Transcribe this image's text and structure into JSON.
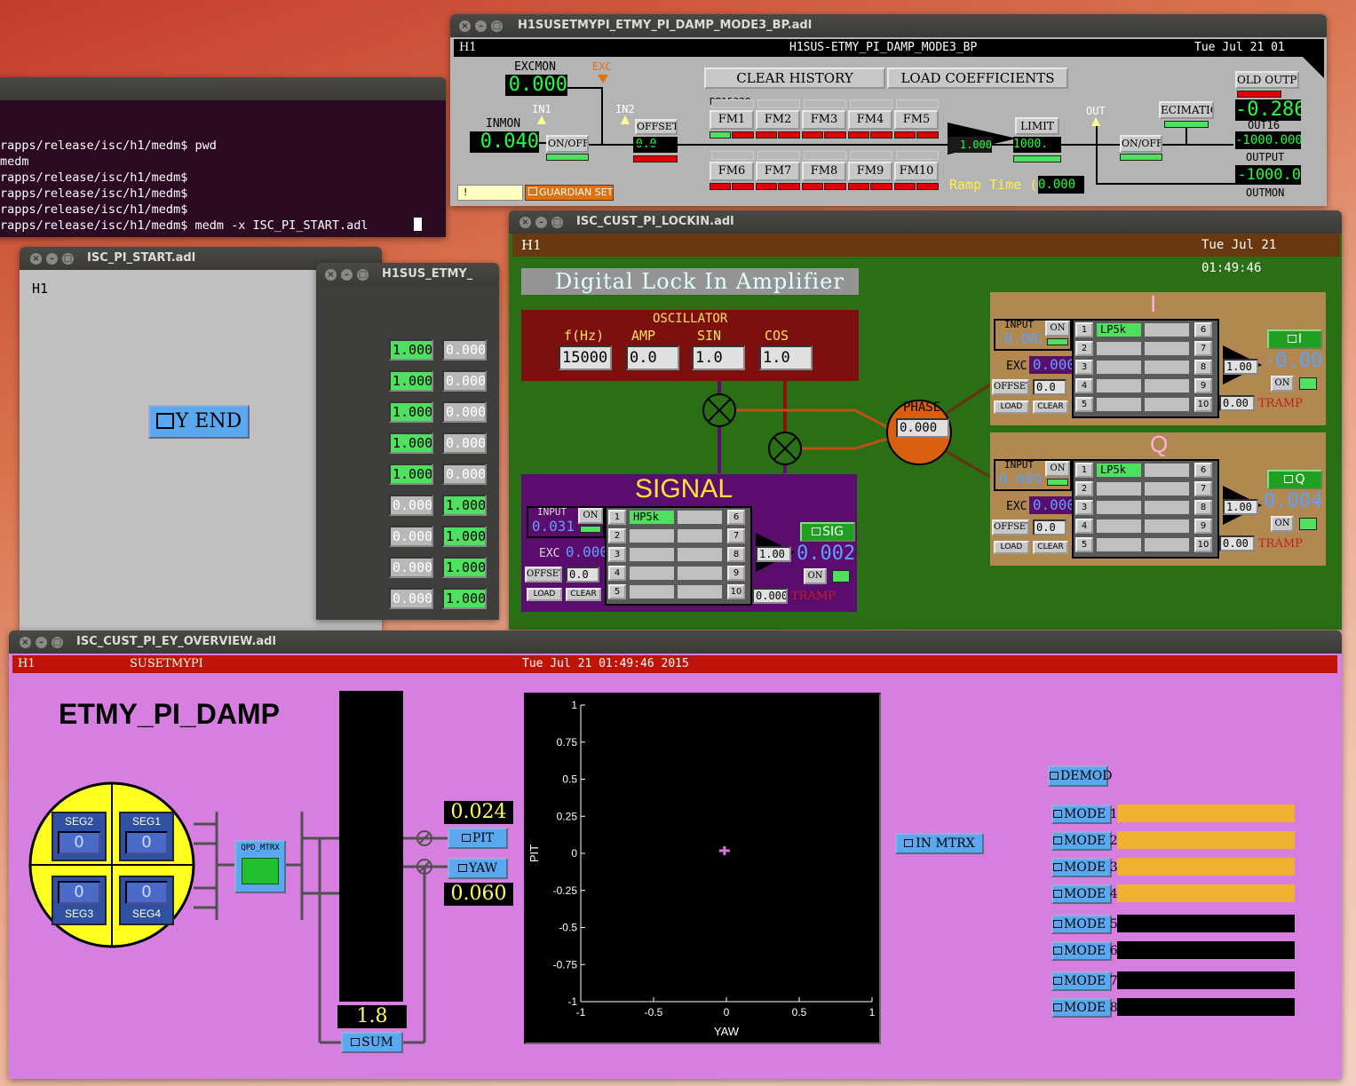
{
  "terminal": {
    "lines": [
      "rapps/release/isc/h1/medm$ pwd",
      "medm",
      "rapps/release/isc/h1/medm$",
      "rapps/release/isc/h1/medm$",
      "rapps/release/isc/h1/medm$",
      "rapps/release/isc/h1/medm$ medm -x ISC_PI_START.adl"
    ]
  },
  "bp": {
    "title": "H1SUSETMYPI_ETMY_PI_DAMP_MODE3_BP.adl",
    "ifo": "H1",
    "header": "H1SUS-ETMY_PI_DAMP_MODE3_BP",
    "date": "Tue Jul 21 01",
    "excmon_label": "EXCMON",
    "excmon_value": "0.000",
    "exc_label": "EXC",
    "inmon_label": "INMON",
    "inmon_value": "0.040",
    "in1": "IN1",
    "in2": "IN2",
    "onoff": "ON/OFF",
    "offset_label": "OFFSET",
    "offset_value": "0.0",
    "clear_history": "CLEAR HISTORY",
    "load_coeff": "LOAD COEFFICIENTS",
    "bp_label": "BP15328",
    "fm_top": [
      "FM1",
      "FM2",
      "FM3",
      "FM4",
      "FM5"
    ],
    "fm_bottom": [
      "FM6",
      "FM7",
      "FM8",
      "FM9",
      "FM10"
    ],
    "gain": "1.000",
    "limit_label": "LIMIT",
    "limit_value": "1000.",
    "out_label": "OUT",
    "onoff2": "ON/OFF",
    "decimation": "ECIMATIO",
    "hold_output": "OLD OUTPU",
    "out16_value": "-0.286",
    "out16_label": "OUT16",
    "output_value": "-1000.000",
    "output_label": "OUTPUT",
    "outmon_value": "-1000.0",
    "outmon_label": "OUTMON",
    "ramp_label": "Ramp Time (s",
    "ramp_value": "0.000",
    "excl": "!",
    "guardian": "GUARDIAN SET"
  },
  "start": {
    "title": "ISC_PI_START.adl",
    "ifo": "H1",
    "yend": "Y END"
  },
  "etmy": {
    "title": "H1SUS_ETMY_",
    "left": [
      "1.000",
      "1.000",
      "1.000",
      "1.000",
      "1.000",
      "0.000",
      "0.000",
      "0.000",
      "0.000"
    ],
    "right": [
      "0.000",
      "0.000",
      "0.000",
      "0.000",
      "0.000",
      "1.000",
      "1.000",
      "1.000",
      "1.000"
    ],
    "active_left": [
      true,
      true,
      true,
      true,
      true,
      false,
      false,
      false,
      false
    ]
  },
  "lockin": {
    "title": "ISC_CUST_PI_LOCKIN.adl",
    "ifo": "H1",
    "date": "Tue Jul 21 01:49:46",
    "heading": "Digital Lock In Amplifier",
    "oscillator": "OSCILLATOR",
    "osc_labels": [
      "f(Hz)",
      "AMP",
      "SIN",
      "COS"
    ],
    "osc_values": [
      "15000",
      "0.0",
      "1.0",
      "1.0"
    ],
    "phase_label": "PHASE",
    "phase_value": "0.000",
    "signal": {
      "title": "SIGNAL",
      "input_label": "INPUT",
      "input_value": "0.031",
      "on": "ON",
      "exc_label": "EXC",
      "exc_value": "0.000",
      "offset_label": "OFFSET",
      "offset_value": "0.0",
      "load": "LOAD",
      "clear": "CLEAR",
      "filter1": "HP5k",
      "gain": "1.00",
      "out_btn": "SIG",
      "out_value": "0.002",
      "tramp_value": "0.000",
      "tramp_label": "TRAMP"
    },
    "i": {
      "title": "I",
      "input_label": "INPUT",
      "input_value": "-0.002",
      "on": "ON",
      "exc_label": "EXC",
      "exc_value": "0.000",
      "offset_label": "OFFSET",
      "offset_value": "0.0",
      "load": "LOAD",
      "clear": "CLEAR",
      "filter1": "LP5k",
      "gain": "1.00",
      "out_btn": "I",
      "out_value": "-0.006",
      "tramp_value": "0.00",
      "tramp_label": "TRAMP"
    },
    "q": {
      "title": "Q",
      "input_label": "INPUT",
      "input_value": "0.009",
      "on": "ON",
      "exc_label": "EXC",
      "exc_value": "0.000",
      "offset_label": "OFFSET",
      "offset_value": "0.0",
      "load": "LOAD",
      "clear": "CLEAR",
      "filter1": "LP5k",
      "gain": "1.00",
      "out_btn": "Q",
      "out_value": "0.004",
      "tramp_value": "0.00",
      "tramp_label": "TRAMP"
    },
    "fm_nums_left": [
      "1",
      "2",
      "3",
      "4",
      "5"
    ],
    "fm_nums_right": [
      "6",
      "7",
      "8",
      "9",
      "10"
    ]
  },
  "overview": {
    "title": "ISC_CUST_PI_EY_OVERVIEW.adl",
    "ifo": "H1",
    "sys": "SUSETMYPI",
    "date": "Tue Jul 21 01:49:46 2015",
    "heading": "ETMY_PI_DAMP",
    "segs": [
      {
        "label": "SEG2",
        "value": "0"
      },
      {
        "label": "SEG1",
        "value": "0"
      },
      {
        "label": "SEG3",
        "value": "0"
      },
      {
        "label": "SEG4",
        "value": "0"
      }
    ],
    "qpd": "QPD_MTRX",
    "pit_value": "0.024",
    "pit_btn": "PIT",
    "yaw_btn": "YAW",
    "yaw_value": "0.060",
    "sum_value": "1.8",
    "sum_btn": "SUM",
    "in_mtrx": "IN MTRX",
    "demod": "DEMOD",
    "modes": [
      "MODE 1",
      "MODE 2",
      "MODE 3",
      "MODE 4",
      "MODE 5",
      "MODE 6",
      "MODE 7",
      "MODE 8"
    ],
    "mode_levels": [
      1,
      1,
      1,
      1,
      0,
      0,
      0,
      0
    ]
  },
  "chart_data": {
    "type": "scatter",
    "xlabel": "YAW",
    "ylabel": "PIT",
    "xlim": [
      -1,
      1
    ],
    "ylim": [
      -1,
      1
    ],
    "xticks": [
      "-1",
      "-0.5",
      "0",
      "0.5",
      "1"
    ],
    "yticks": [
      "1",
      "0.75",
      "0.5",
      "0.25",
      "0",
      "-0.25",
      "-0.5",
      "-0.75",
      "-1"
    ],
    "points": [
      {
        "x": 0.06,
        "y": 0.024
      }
    ],
    "colors": {
      "point": "#e070e0",
      "bg": "#000000"
    }
  },
  "colors": {
    "overview_bg": "#d67fe0",
    "lockin_bg": "#2a6e16",
    "signal_bg": "#5a0d6c",
    "osc_bg": "#7e0f0f",
    "iq_bg": "#b08850",
    "phase": "#e06a10"
  }
}
